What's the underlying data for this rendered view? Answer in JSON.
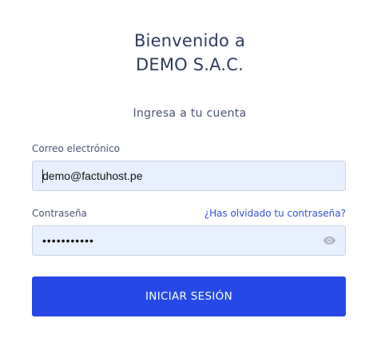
{
  "header": {
    "welcome_line1": "Bienvenido a",
    "welcome_line2": "DEMO S.A.C.",
    "subtitle": "Ingresa a tu cuenta"
  },
  "form": {
    "email": {
      "label": "Correo electrónico",
      "value": "demo@factuhost.pe"
    },
    "password": {
      "label": "Contraseña",
      "value": "•••••••••••",
      "forgot_link": "¿Has olvidado tu contraseña?",
      "toggle_icon": "eye-icon"
    },
    "submit_label": "INICIAR SESIÓN"
  },
  "colors": {
    "primary_button": "#2548e6",
    "link": "#3350d6",
    "input_background": "#e8f0fe",
    "heading_text": "#2e3b5b"
  }
}
